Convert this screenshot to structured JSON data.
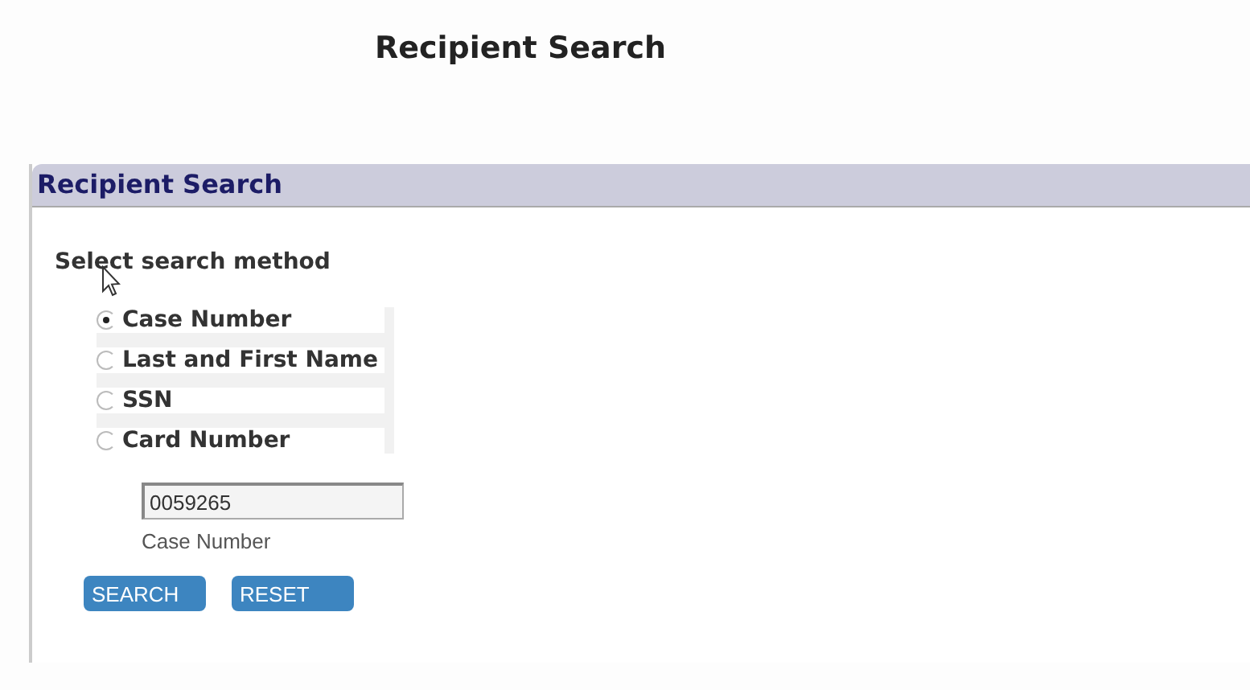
{
  "page_title": "Recipient Search",
  "panel": {
    "title": "Recipient Search",
    "prompt": "Select search method",
    "methods": [
      {
        "label": "Case Number",
        "selected": true
      },
      {
        "label": "Last and First Name",
        "selected": false
      },
      {
        "label": "SSN",
        "selected": false
      },
      {
        "label": "Card Number",
        "selected": false
      }
    ],
    "field": {
      "value": "0059265",
      "caption": "Case Number"
    },
    "buttons": [
      "SEARCH",
      "RESET"
    ]
  }
}
